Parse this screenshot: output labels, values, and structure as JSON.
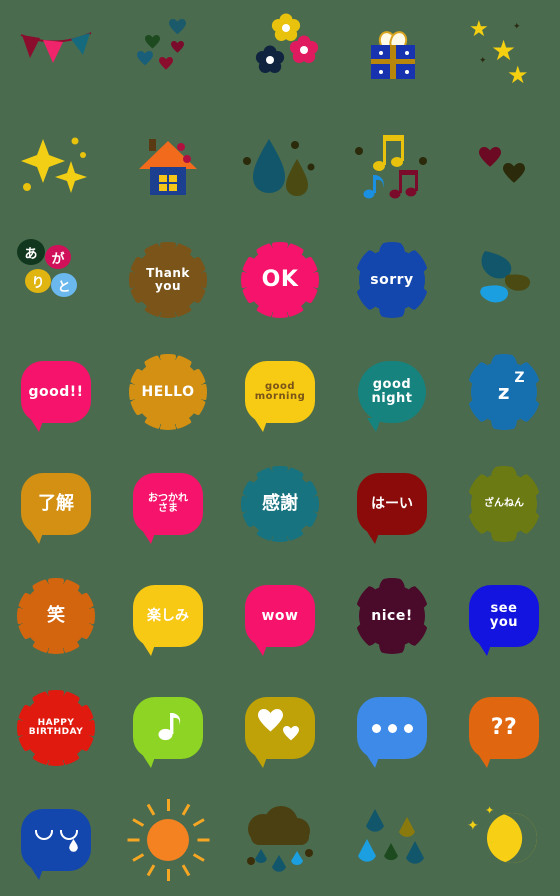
{
  "page": {
    "title": "Emoji sticker sheet",
    "background_color": "#4a6b4d",
    "columns": 5,
    "rows": 8
  },
  "stickers": [
    {
      "id": "bunting",
      "name": "bunting-flags",
      "label": "",
      "kind": "art",
      "colors": [
        "#8b0d2e",
        "#f0246b",
        "#156b7d"
      ]
    },
    {
      "id": "hearts-cluster",
      "name": "hearts-cluster",
      "label": "",
      "kind": "art",
      "colors": [
        "#1b5a6b",
        "#1d4a1f",
        "#7a0b2b",
        "#1a5f7a",
        "#8b0d2e"
      ]
    },
    {
      "id": "flowers",
      "name": "three-flowers",
      "label": "",
      "kind": "art",
      "colors": [
        "#e8c20d",
        "#e01a5f",
        "#10243f"
      ]
    },
    {
      "id": "gift",
      "name": "gift-box",
      "label": "",
      "kind": "art",
      "colors": [
        "#1833b0",
        "#b8860b",
        "#fffbe8"
      ]
    },
    {
      "id": "stars",
      "name": "three-stars",
      "label": "",
      "kind": "art",
      "colors": [
        "#f5d011"
      ]
    },
    {
      "id": "sparkle-stars",
      "name": "sparkle-stars",
      "label": "",
      "kind": "art",
      "colors": [
        "#f2cf15"
      ]
    },
    {
      "id": "house",
      "name": "house",
      "label": "",
      "kind": "art",
      "colors": [
        "#f26a1b",
        "#1c3f8f",
        "#f5c518"
      ]
    },
    {
      "id": "trees",
      "name": "two-trees",
      "label": "",
      "kind": "art",
      "colors": [
        "#12566b",
        "#4a4a12"
      ]
    },
    {
      "id": "music-notes",
      "name": "music-notes",
      "label": "",
      "kind": "art",
      "colors": [
        "#e8c20d",
        "#1b8fe0",
        "#7a0b2b"
      ]
    },
    {
      "id": "two-hearts",
      "name": "two-hearts",
      "label": "",
      "kind": "art",
      "colors": [
        "#6b0a22",
        "#2b2a0a"
      ]
    },
    {
      "id": "arigato",
      "name": "arigato-bubbles",
      "label": "",
      "kind": "multi-bubble",
      "chars": [
        "あ",
        "が",
        "り",
        "と"
      ],
      "colors": [
        "#11381f",
        "#d1105a",
        "#e0b411",
        "#6ab8ee"
      ]
    },
    {
      "id": "thankyou",
      "name": "bubble-thank-you",
      "label": "Thank\nyou",
      "kind": "scallop",
      "color": "#7a5418",
      "text_color": "#ffffff"
    },
    {
      "id": "ok",
      "name": "bubble-ok",
      "label": "OK",
      "kind": "scallop",
      "color": "#f5136b",
      "text_color": "#ffffff"
    },
    {
      "id": "sorry",
      "name": "bubble-sorry",
      "label": "sorry",
      "kind": "cloudy",
      "color": "#1447ad",
      "text_color": "#ffffff"
    },
    {
      "id": "petals",
      "name": "three-petals",
      "label": "",
      "kind": "art",
      "colors": [
        "#12566b",
        "#4a4a12",
        "#1b9fe0"
      ]
    },
    {
      "id": "good",
      "name": "bubble-good",
      "label": "good!!",
      "kind": "rect",
      "color": "#f5136b",
      "text_color": "#ffffff"
    },
    {
      "id": "hello",
      "name": "bubble-hello",
      "label": "HELLO",
      "kind": "scallop",
      "color": "#d39012",
      "text_color": "#ffffff"
    },
    {
      "id": "goodmorning",
      "name": "bubble-good-morning",
      "label": "good\nmorning",
      "kind": "rect",
      "color": "#f7ca14",
      "text_color": "#7a5418"
    },
    {
      "id": "goodnight",
      "name": "bubble-good-night",
      "label": "good\nnight",
      "kind": "round",
      "color": "#17837f",
      "text_color": "#ffffff"
    },
    {
      "id": "zzz",
      "name": "bubble-zzz",
      "label": "z",
      "label2": "Z",
      "kind": "cloudy",
      "color": "#1670b0",
      "text_color": "#ffffff"
    },
    {
      "id": "ryoukai",
      "name": "bubble-ryoukai",
      "label": "了解",
      "kind": "rect",
      "color": "#d39012",
      "text_color": "#ffffff"
    },
    {
      "id": "otsukare",
      "name": "bubble-otsukaresama",
      "label": "おつかれ\nさま",
      "kind": "rect",
      "color": "#f5136b",
      "text_color": "#ffffff"
    },
    {
      "id": "kansha",
      "name": "bubble-kansha",
      "label": "感謝",
      "kind": "scallop",
      "color": "#17737f",
      "text_color": "#ffffff"
    },
    {
      "id": "haai",
      "name": "bubble-haai",
      "label": "はーい",
      "kind": "rect",
      "color": "#8b0a0a",
      "text_color": "#ffffff"
    },
    {
      "id": "zannen",
      "name": "bubble-zannen",
      "label": "ざんねん",
      "kind": "cloudy",
      "color": "#6b7a12",
      "text_color": "#ffffff"
    },
    {
      "id": "warai",
      "name": "bubble-warai",
      "label": "笑",
      "kind": "scallop",
      "color": "#d4650f",
      "text_color": "#ffffff"
    },
    {
      "id": "tanoshimi",
      "name": "bubble-tanoshimi",
      "label": "楽しみ",
      "kind": "rect",
      "color": "#f7c814",
      "text_color": "#ffffff"
    },
    {
      "id": "wow",
      "name": "bubble-wow",
      "label": "wow",
      "kind": "rect",
      "color": "#f5136b",
      "text_color": "#ffffff"
    },
    {
      "id": "nice",
      "name": "bubble-nice",
      "label": "nice!",
      "kind": "cloudy",
      "color": "#4a0a2a",
      "text_color": "#ffffff"
    },
    {
      "id": "seeyou",
      "name": "bubble-see-you",
      "label": "see\nyou",
      "kind": "rect",
      "color": "#1414e0",
      "text_color": "#ffffff"
    },
    {
      "id": "happybirthday",
      "name": "bubble-happy-birthday",
      "label": "HAPPY\nBIRTHDAY",
      "kind": "scallop",
      "color": "#e01a0f",
      "text_color": "#ffffff"
    },
    {
      "id": "note-bubble",
      "name": "bubble-music-note",
      "label": "",
      "kind": "rect",
      "color": "#8ed424",
      "text_color": "#ffffff",
      "icon": "music-note"
    },
    {
      "id": "hearts-bubble",
      "name": "bubble-hearts",
      "label": "",
      "kind": "rect",
      "color": "#bfa108",
      "text_color": "#ffffff",
      "icon": "hearts"
    },
    {
      "id": "dots-bubble",
      "name": "bubble-ellipsis",
      "label": "",
      "kind": "rect",
      "color": "#3d8ae8",
      "text_color": "#ffffff",
      "icon": "ellipsis"
    },
    {
      "id": "question-bubble",
      "name": "bubble-question-marks",
      "label": "??",
      "kind": "rect",
      "color": "#e0660f",
      "text_color": "#ffffff"
    },
    {
      "id": "crying",
      "name": "bubble-crying-face",
      "label": "",
      "kind": "rect",
      "color": "#1447ad",
      "text_color": "#ffffff",
      "icon": "crying-face"
    },
    {
      "id": "sun",
      "name": "sun",
      "label": "",
      "kind": "art",
      "colors": [
        "#f58220",
        "#f5a623"
      ]
    },
    {
      "id": "raincloud",
      "name": "rain-cloud",
      "label": "",
      "kind": "art",
      "colors": [
        "#4a4012",
        "#1b9fe0",
        "#12566b"
      ]
    },
    {
      "id": "raindrops",
      "name": "raindrops",
      "label": "",
      "kind": "art",
      "colors": [
        "#12566b",
        "#8a7a0d",
        "#1b9fe0",
        "#1d4a1f",
        "#12566b"
      ]
    },
    {
      "id": "moon",
      "name": "crescent-moon",
      "label": "",
      "kind": "art",
      "colors": [
        "#f7cf14"
      ]
    }
  ]
}
